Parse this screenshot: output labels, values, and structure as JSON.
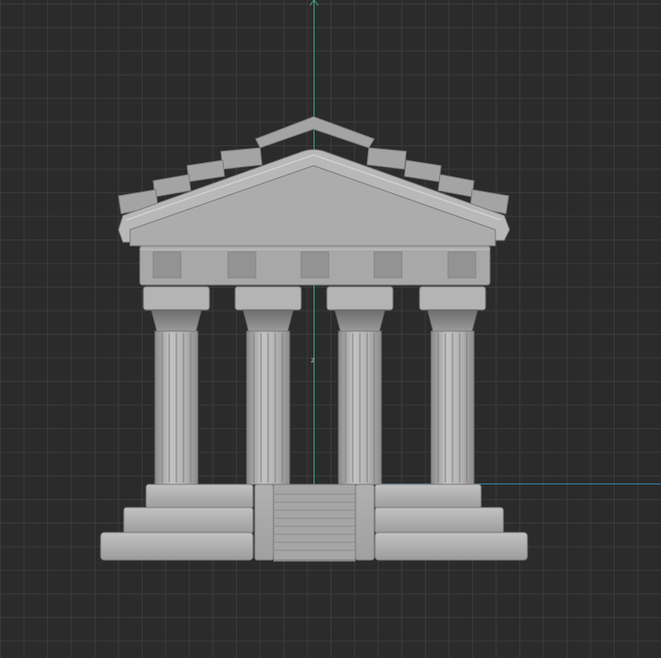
{
  "viewport": {
    "background_color": "#2b2b2b",
    "grid_color": "#3b3b3b",
    "y_axis_color": "#3fa88a",
    "x_axis_color": "#3a7fa8",
    "model_color": "#a9a9a9"
  },
  "model": {
    "name": "temple-model",
    "columns": 4,
    "frieze_metopes": 5
  }
}
